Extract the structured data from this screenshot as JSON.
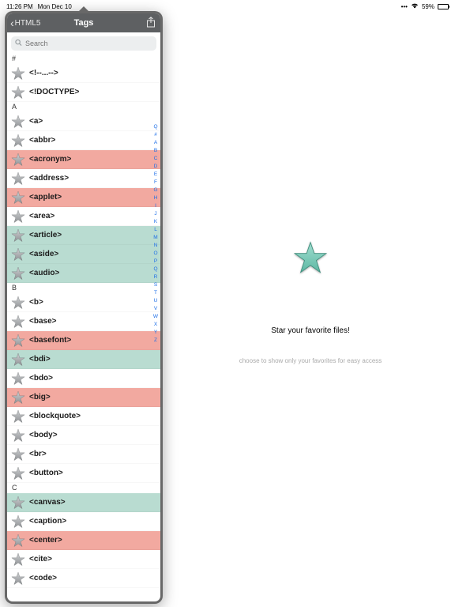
{
  "status": {
    "time": "11:26 PM",
    "date": "Mon Dec 10",
    "battery_pct": "59%"
  },
  "detail": {
    "title": "Star your favorite files!",
    "subtitle": "choose to show only your favorites for easy access"
  },
  "panel": {
    "back_label": "HTML5",
    "title": "Tags",
    "search_placeholder": "Search"
  },
  "index_letters": [
    "Q",
    "#",
    "A",
    "B",
    "C",
    "D",
    "E",
    "F",
    "G",
    "H",
    "I",
    "J",
    "K",
    "L",
    "M",
    "N",
    "O",
    "P",
    "Q",
    "R",
    "S",
    "T",
    "U",
    "V",
    "W",
    "X",
    "Y",
    "Z"
  ],
  "sections": [
    {
      "header": "#",
      "rows": [
        {
          "label": "<!--...-->",
          "style": "white"
        },
        {
          "label": "<!DOCTYPE>",
          "style": "white"
        }
      ]
    },
    {
      "header": "A",
      "rows": [
        {
          "label": "<a>",
          "style": "white"
        },
        {
          "label": "<abbr>",
          "style": "white"
        },
        {
          "label": "<acronym>",
          "style": "red"
        },
        {
          "label": "<address>",
          "style": "white"
        },
        {
          "label": "<applet>",
          "style": "red"
        },
        {
          "label": "<area>",
          "style": "white"
        },
        {
          "label": "<article>",
          "style": "green"
        },
        {
          "label": "<aside>",
          "style": "green"
        },
        {
          "label": "<audio>",
          "style": "green"
        }
      ]
    },
    {
      "header": "B",
      "rows": [
        {
          "label": "<b>",
          "style": "white"
        },
        {
          "label": "<base>",
          "style": "white"
        },
        {
          "label": "<basefont>",
          "style": "red"
        },
        {
          "label": "<bdi>",
          "style": "green"
        },
        {
          "label": "<bdo>",
          "style": "white"
        },
        {
          "label": "<big>",
          "style": "red"
        },
        {
          "label": "<blockquote>",
          "style": "white"
        },
        {
          "label": "<body>",
          "style": "white"
        },
        {
          "label": "<br>",
          "style": "white"
        },
        {
          "label": "<button>",
          "style": "white"
        }
      ]
    },
    {
      "header": "C",
      "rows": [
        {
          "label": "<canvas>",
          "style": "green"
        },
        {
          "label": "<caption>",
          "style": "white"
        },
        {
          "label": "<center>",
          "style": "red"
        },
        {
          "label": "<cite>",
          "style": "white"
        },
        {
          "label": "<code>",
          "style": "white"
        }
      ]
    }
  ]
}
